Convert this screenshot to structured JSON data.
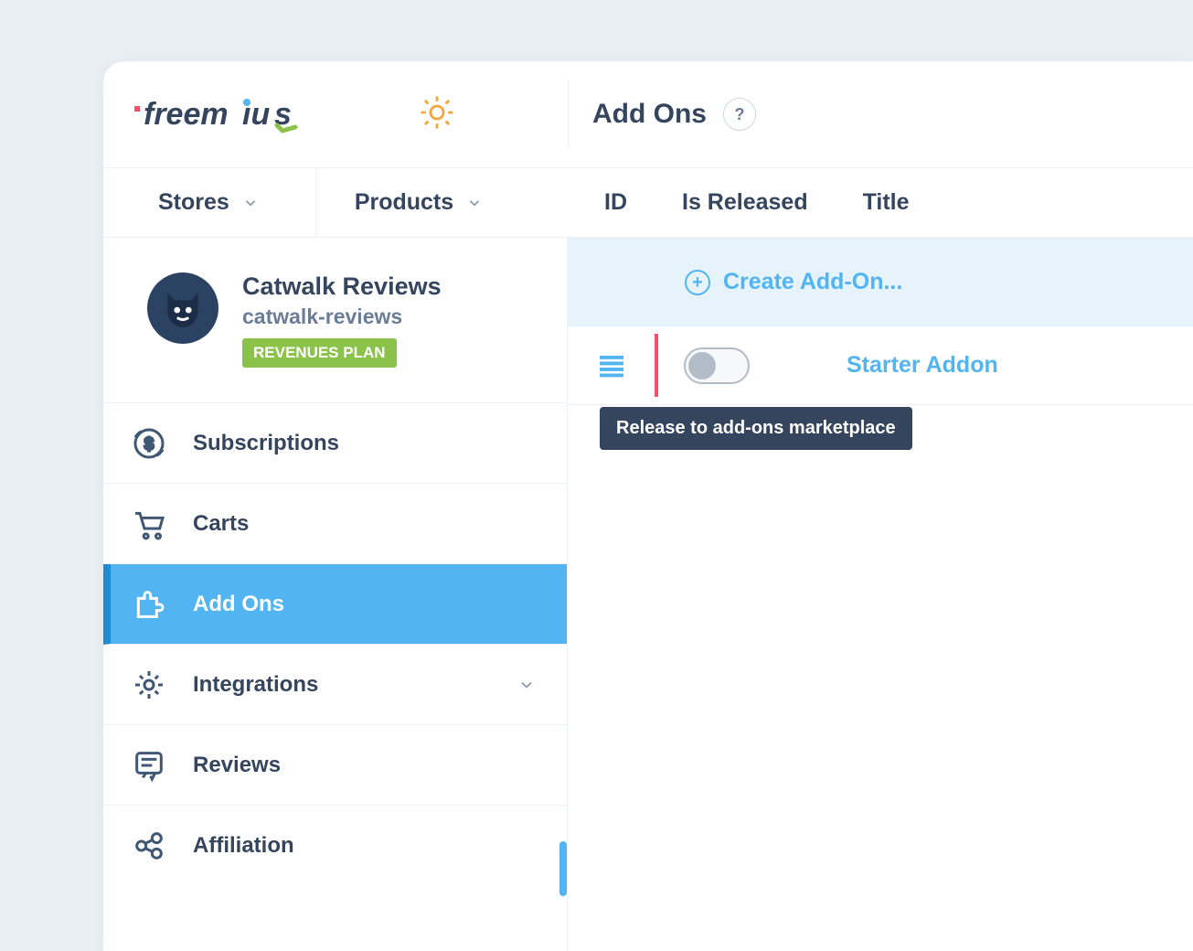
{
  "brand": {
    "name": "freemius"
  },
  "header": {
    "page_title": "Add Ons",
    "help_label": "?"
  },
  "subnav": {
    "stores_label": "Stores",
    "products_label": "Products"
  },
  "columns": {
    "id": "ID",
    "is_released": "Is Released",
    "title": "Title"
  },
  "product": {
    "name": "Catwalk Reviews",
    "slug": "catwalk-reviews",
    "plan_badge": "REVENUES PLAN"
  },
  "sidebar": {
    "items": [
      {
        "label": "Subscriptions"
      },
      {
        "label": "Carts"
      },
      {
        "label": "Add Ons"
      },
      {
        "label": "Integrations"
      },
      {
        "label": "Reviews"
      },
      {
        "label": "Affiliation"
      }
    ]
  },
  "create": {
    "label": "Create Add-On..."
  },
  "addons": [
    {
      "title": "Starter Addon",
      "released": false
    }
  ],
  "tooltip": {
    "release": "Release to add-ons marketplace"
  }
}
